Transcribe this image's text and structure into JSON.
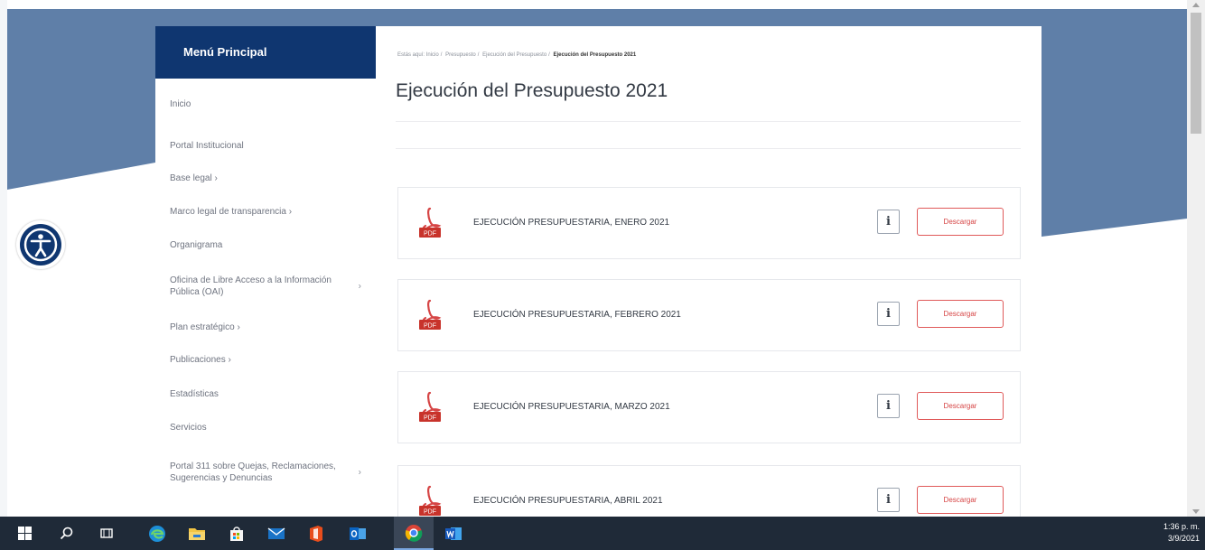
{
  "colors": {
    "brand_navy": "#0f3670",
    "background_band": "#5f7fa8",
    "accent_red": "#d64545"
  },
  "sidebar": {
    "header": "Menú Principal",
    "items": [
      {
        "label": "Inicio",
        "has_chevron": false
      },
      {
        "label": "Portal Institucional",
        "has_chevron": false
      },
      {
        "label": "Base legal ›",
        "has_chevron": false
      },
      {
        "label": "Marco legal de transparencia ›",
        "has_chevron": false
      },
      {
        "label": "Organigrama",
        "has_chevron": false
      },
      {
        "label": "Oficina de Libre Acceso a la Información Pública (OAI)",
        "has_chevron": true
      },
      {
        "label": "Plan estratégico ›",
        "has_chevron": false
      },
      {
        "label": "Publicaciones ›",
        "has_chevron": false
      },
      {
        "label": "Estadísticas",
        "has_chevron": false
      },
      {
        "label": "Servicios",
        "has_chevron": false
      },
      {
        "label": "Portal 311 sobre Quejas, Reclamaciones, Sugerencias y Denuncias",
        "has_chevron": true
      }
    ]
  },
  "breadcrumb": {
    "prefix": "Estás aquí:",
    "items": [
      "Inicio",
      "Presupuesto",
      "Ejecución del Presupuesto"
    ],
    "current": "Ejecución del Presupuesto 2021"
  },
  "page": {
    "title": "Ejecución del Presupuesto 2021"
  },
  "documents": [
    {
      "title": "EJECUCIÓN PRESUPUESTARIA, ENERO 2021",
      "info_label": "i",
      "download_label": "Descargar",
      "icon": "pdf-icon",
      "badge": "PDF"
    },
    {
      "title": "EJECUCIÓN PRESUPUESTARIA, FEBRERO 2021",
      "info_label": "i",
      "download_label": "Descargar",
      "icon": "pdf-icon",
      "badge": "PDF"
    },
    {
      "title": "EJECUCIÓN PRESUPUESTARIA, MARZO 2021",
      "info_label": "i",
      "download_label": "Descargar",
      "icon": "pdf-icon",
      "badge": "PDF"
    },
    {
      "title": "EJECUCIÓN PRESUPUESTARIA, ABRIL 2021",
      "info_label": "i",
      "download_label": "Descargar",
      "icon": "pdf-icon",
      "badge": "PDF"
    }
  ],
  "accessibility": {
    "icon": "accessibility-icon"
  },
  "taskbar": {
    "icons": [
      "windows-start-icon",
      "search-icon",
      "task-view-icon",
      "edge-icon",
      "file-explorer-icon",
      "store-icon",
      "mail-icon",
      "office-icon",
      "outlook-icon",
      "chrome-icon",
      "word-icon"
    ],
    "time": "1:36 p. m.",
    "date": "3/9/2021"
  }
}
